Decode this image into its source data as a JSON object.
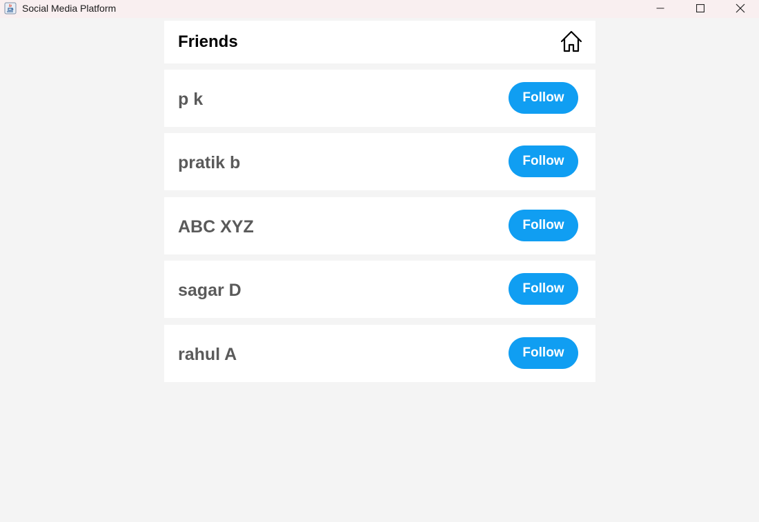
{
  "window": {
    "title": "Social Media Platform"
  },
  "header": {
    "title": "Friends",
    "home_icon": "home-icon"
  },
  "friends": [
    {
      "name": "p k",
      "action_label": "Follow"
    },
    {
      "name": "pratik b",
      "action_label": "Follow"
    },
    {
      "name": "ABC XYZ",
      "action_label": "Follow"
    },
    {
      "name": "sagar D",
      "action_label": "Follow"
    },
    {
      "name": "rahul A",
      "action_label": "Follow"
    }
  ],
  "colors": {
    "accent": "#109ef2",
    "background": "#f4f4f4",
    "card": "#ffffff",
    "name_text": "#5a5a5a"
  }
}
